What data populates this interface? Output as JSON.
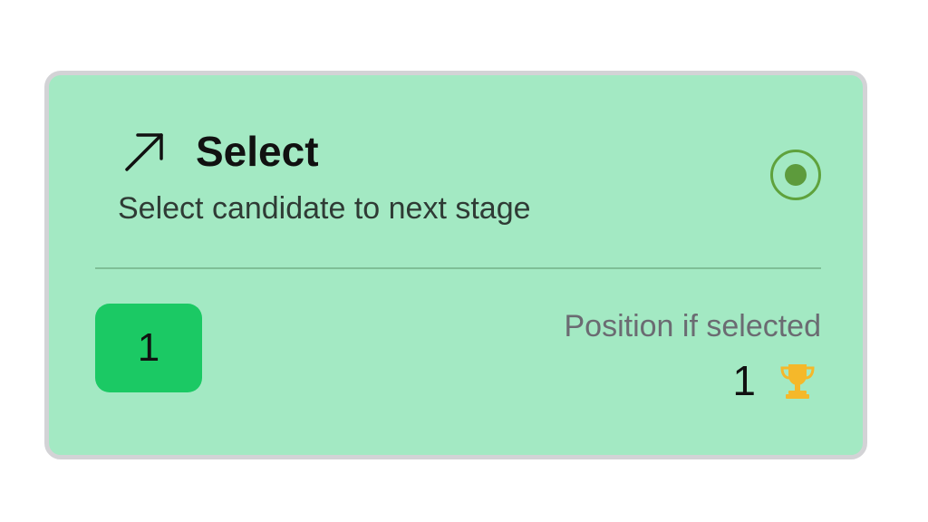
{
  "option": {
    "icon": "arrow-up-right-icon",
    "title": "Select",
    "description": "Select candidate to next stage",
    "selected": true
  },
  "badge": {
    "value": "1"
  },
  "position": {
    "label": "Position if selected",
    "value": "1",
    "icon": "trophy-icon"
  },
  "colors": {
    "card_background": "#a3e9c3",
    "badge_background": "#1bc964",
    "radio_accent": "#5d9b3c",
    "trophy": "#f5b82a"
  }
}
